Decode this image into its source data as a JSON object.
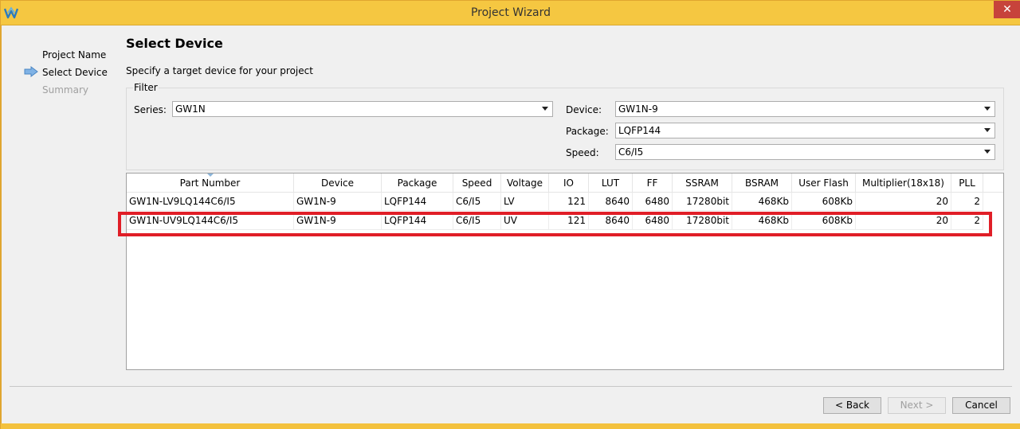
{
  "window": {
    "title": "Project Wizard",
    "close_label": "✕"
  },
  "steps": [
    {
      "label": "Project Name",
      "state": "done"
    },
    {
      "label": "Select Device",
      "state": "current"
    },
    {
      "label": "Summary",
      "state": "pending"
    }
  ],
  "page": {
    "heading": "Select Device",
    "subheading": "Specify a target device for your project"
  },
  "filter": {
    "label": "Filter",
    "series_label": "Series:",
    "series_value": "GW1N",
    "device_label": "Device:",
    "device_value": "GW1N-9",
    "package_label": "Package:",
    "package_value": "LQFP144",
    "speed_label": "Speed:",
    "speed_value": "C6/I5"
  },
  "table": {
    "columns": [
      "Part Number",
      "Device",
      "Package",
      "Speed",
      "Voltage",
      "IO",
      "LUT",
      "FF",
      "SSRAM",
      "BSRAM",
      "User Flash",
      "Multiplier(18x18)",
      "PLL"
    ],
    "rows": [
      [
        "GW1N-LV9LQ144C6/I5",
        "GW1N-9",
        "LQFP144",
        "C6/I5",
        "LV",
        "121",
        "8640",
        "6480",
        "17280bit",
        "468Kb",
        "608Kb",
        "20",
        "2"
      ],
      [
        "GW1N-UV9LQ144C6/I5",
        "GW1N-9",
        "LQFP144",
        "C6/I5",
        "UV",
        "121",
        "8640",
        "6480",
        "17280bit",
        "468Kb",
        "608Kb",
        "20",
        "2"
      ]
    ]
  },
  "buttons": {
    "back": "< Back",
    "next": "Next >",
    "cancel": "Cancel"
  },
  "colors": {
    "titlebar": "#f5c741",
    "highlight": "#e01e27",
    "close": "#c7433b"
  }
}
